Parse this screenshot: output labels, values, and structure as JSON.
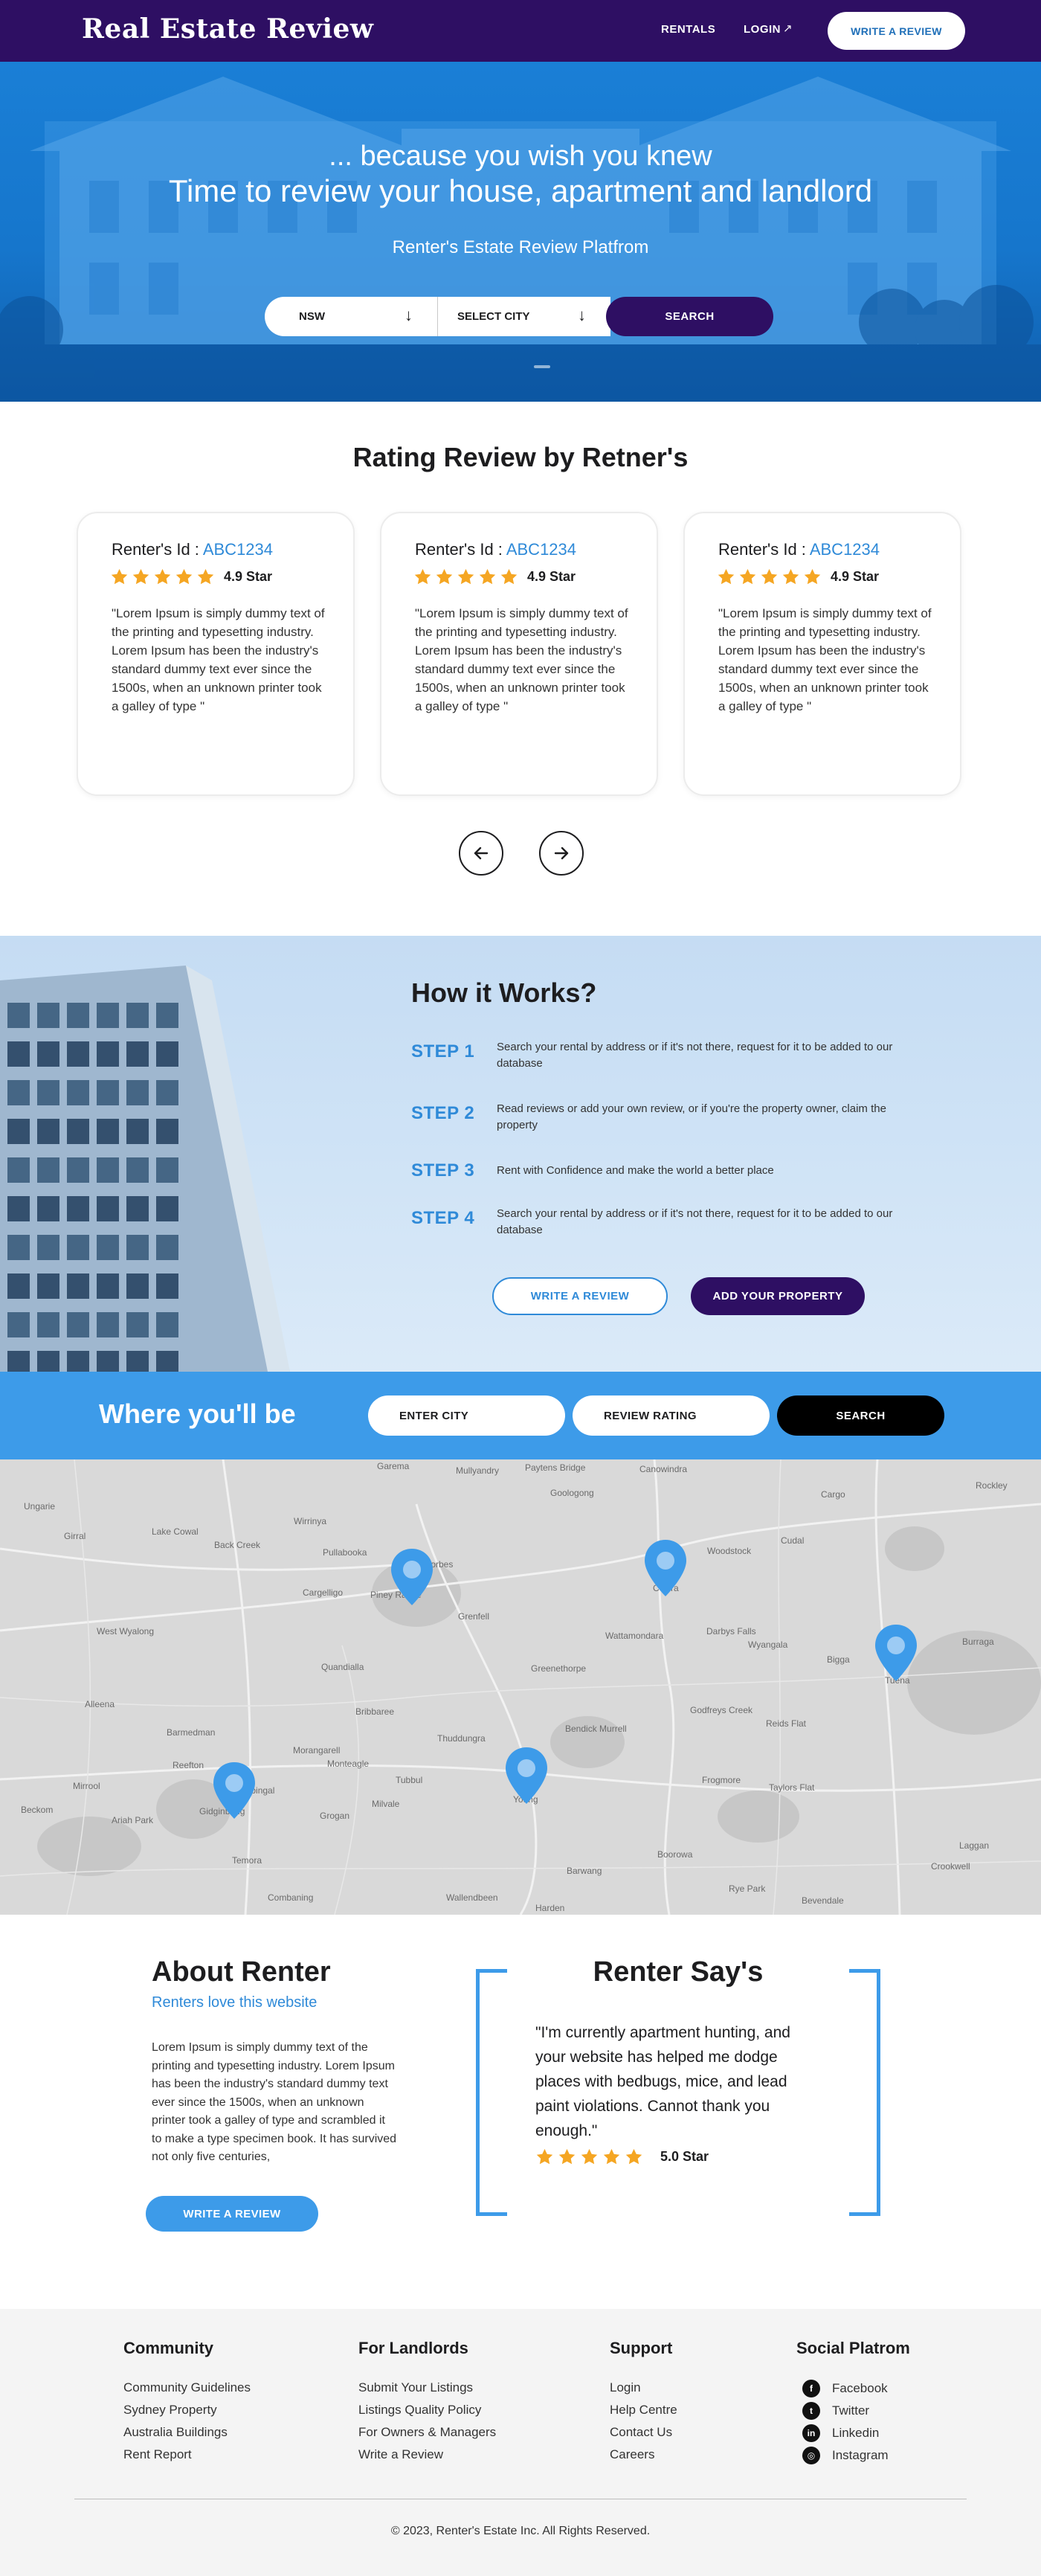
{
  "nav": {
    "logo": "Real Estate Review",
    "links": [
      "RENTALS",
      "LOGIN"
    ],
    "cta": "WRITE A REVIEW",
    "login_icon": "external-arrow-icon"
  },
  "hero": {
    "tagline": "... because you wish you knew",
    "title": "Time to review your house, apartment and landlord",
    "subtitle": "Renter's Estate Review Platfrom",
    "state_select": "NSW",
    "city_select": "SELECT CITY",
    "search_button": "SEARCH"
  },
  "reviews": {
    "title": "Rating Review by Retner's",
    "cards": [
      {
        "id_label": "Renter's Id : ",
        "id_value": "ABC1234",
        "stars": 5,
        "rating": "4.9 Star",
        "text": "\"Lorem Ipsum is simply dummy text of the printing and typesetting industry. Lorem Ipsum has been the industry's standard dummy text ever since the 1500s, when an unknown printer took a galley of type \""
      },
      {
        "id_label": "Renter's Id : ",
        "id_value": "ABC1234",
        "stars": 5,
        "rating": "4.9 Star",
        "text": "\"Lorem Ipsum is simply dummy text of the printing and typesetting industry. Lorem Ipsum has been the industry's standard dummy text ever since the 1500s, when an unknown printer took a galley of type \""
      },
      {
        "id_label": "Renter's Id : ",
        "id_value": "ABC1234",
        "stars": 5,
        "rating": "4.9 Star",
        "text": "\"Lorem Ipsum is simply dummy text of the printing and typesetting industry. Lorem Ipsum has been the industry's standard dummy text ever since the 1500s, when an unknown printer took a galley of type \""
      }
    ],
    "prev_icon": "arrow-left-icon",
    "next_icon": "arrow-right-icon"
  },
  "how": {
    "title": "How it Works?",
    "steps": [
      {
        "label": "STEP 1",
        "text": "Search your rental by address or if it's not there, request for it to be added to our database"
      },
      {
        "label": "STEP 2",
        "text": "Read reviews or add your own review, or if you're the property owner, claim the property"
      },
      {
        "label": "STEP 3",
        "text": "Rent with Confidence and make the world a better place"
      },
      {
        "label": "STEP 4",
        "text": "Search your rental by address or if it's not there, request for it to be added to our database"
      }
    ],
    "write_button": "WRITE A REVIEW",
    "add_button": "ADD YOUR PROPERTY"
  },
  "where": {
    "title": "Where you'll be",
    "city_input": "ENTER CITY",
    "rating_input": "REVIEW RATING",
    "search_button": "SEARCH"
  },
  "map": {
    "places": [
      "Garema",
      "Mullyandry",
      "Paytens Bridge",
      "Canowindra",
      "Ungarie",
      "Goologong",
      "Cargo",
      "Rockley",
      "Lake Cowal",
      "Wirrinya",
      "Back Creek",
      "Forbes",
      "Cudal",
      "Woodstock",
      "Girral",
      "Pullabooka",
      "Cargelligo",
      "Piney Range",
      "Grenfell",
      "Cowra",
      "Darbys Falls",
      "West Wyalong",
      "Quandialla",
      "Wattamondara",
      "Wyangala",
      "Burraga",
      "Greenethorpe",
      "Bigga",
      "Tuena",
      "Alleena",
      "Bribbaree",
      "Bendick Murrell",
      "Godfreys Creek",
      "Reids Flat",
      "Barmedman",
      "Thuddungra",
      "Morangarell",
      "Reefton",
      "Monteagle",
      "Tubbul",
      "Young",
      "Frogmore",
      "Mirrool",
      "Stockinbingal",
      "Milvale",
      "Taylors Flat",
      "Beckom",
      "Ariah Park",
      "Gidginbung",
      "Grogan",
      "Temora",
      "Laggan",
      "Boorowa",
      "Barwang",
      "Crookwell",
      "Combaning",
      "Wallendbeen",
      "Harden",
      "Rye Park",
      "Bevendale"
    ],
    "pin_icon": "map-pin-icon"
  },
  "about": {
    "title": "About Renter",
    "subtitle": "Renters love this website",
    "text": "Lorem Ipsum is simply dummy text of the printing and typesetting industry. Lorem Ipsum has been the industry's standard dummy text ever since the 1500s, when an unknown printer took a galley of type and scrambled it to make a type specimen book. It has survived not only five centuries,",
    "button": "WRITE A REVIEW"
  },
  "say": {
    "title": "Renter Say's",
    "quote": "\"I'm currently apartment hunting, and your website has helped me dodge places with bedbugs, mice, and lead paint violations. Cannot thank you enough.\"",
    "stars": 5,
    "rating": "5.0 Star"
  },
  "footer": {
    "columns": [
      {
        "heading": "Community",
        "links": [
          "Community Guidelines",
          "Sydney Property",
          "Australia Buildings",
          "Rent Report"
        ]
      },
      {
        "heading": "For Landlords",
        "links": [
          "Submit Your Listings",
          "Listings Quality Policy",
          "For Owners & Managers",
          "Write a Review"
        ]
      },
      {
        "heading": "Support",
        "links": [
          "Login",
          "Help Centre",
          "Contact Us",
          "Careers"
        ]
      },
      {
        "heading": "Social Platrom",
        "links": [
          "Facebook",
          "Twitter",
          "Linkedin",
          "Instagram"
        ]
      }
    ],
    "social_icons": [
      "facebook-icon",
      "twitter-icon",
      "linkedin-icon",
      "instagram-icon"
    ],
    "copyright": "© 2023, Renter's Estate Inc. All Rights Reserved."
  },
  "colors": {
    "nav_bg": "#2e0f63",
    "accent_blue": "#3d9be9",
    "link_blue": "#2f8ad8",
    "star": "#f5a623"
  }
}
